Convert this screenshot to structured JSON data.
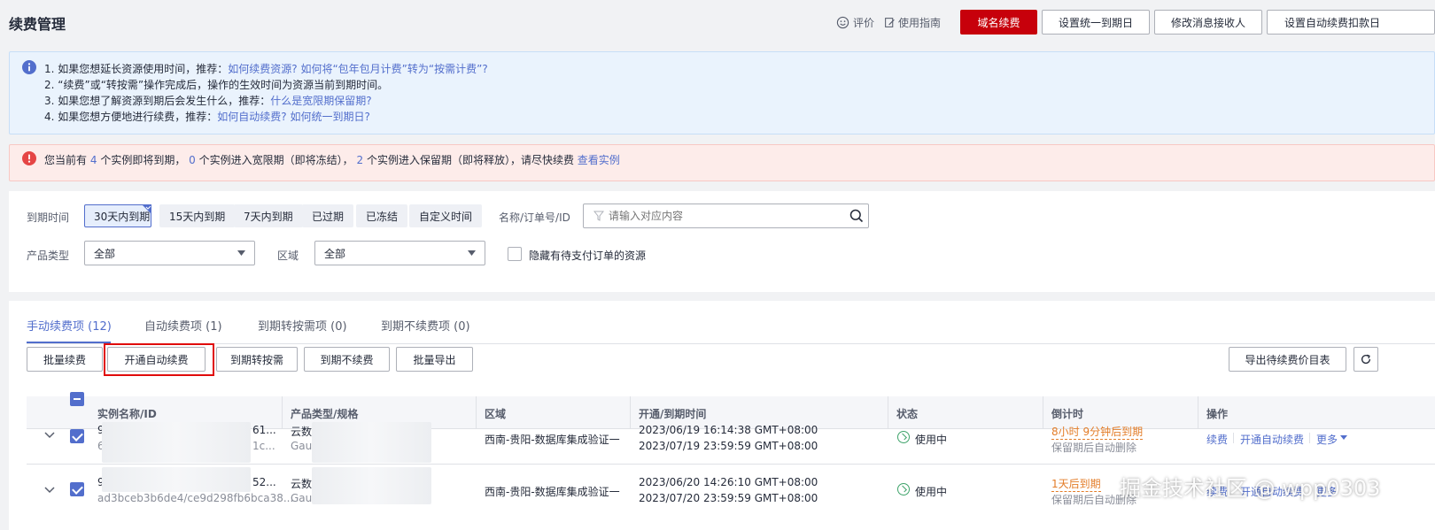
{
  "header": {
    "title": "续费管理",
    "rate_label": "评价",
    "guide_label": "使用指南",
    "buttons": [
      "域名续费",
      "设置统一到期日",
      "修改消息接收人",
      "设置自动续费扣款日"
    ]
  },
  "info": {
    "l1_text": "1. 如果您想延长资源使用时间，推荐：",
    "l1_link1": "如何续费资源?",
    "l1_link2": "如何将“包年包月计费”转为“按需计费”?",
    "l2_text": "2. “续费”或“转按需”操作完成后，操作的生效时间为资源当前到期时间。",
    "l3_text": "3. 如果您想了解资源到期后会发生什么，推荐：",
    "l3_link": "什么是宽限期保留期?",
    "l4_text": "4. 如果您想方便地进行续费，推荐：",
    "l4_link1": "如何自动续费?",
    "l4_link2": "如何统一到期日?"
  },
  "warning": {
    "p1": "您当前有",
    "n1": "4",
    "p2": "个实例即将到期，",
    "n2": "0",
    "p3": "个实例进入宽限期（即将冻结），",
    "n3": "2",
    "p4": "个实例进入保留期（即将释放），请尽快续费",
    "link": "查看实例"
  },
  "filters": {
    "expire_label": "到期时间",
    "chips": [
      "30天内到期",
      "15天内到期",
      "7天内到期",
      "已过期",
      "已冻结",
      "自定义时间"
    ],
    "search_label": "名称/订单号/ID",
    "search_placeholder": "请输入对应内容",
    "product_label": "产品类型",
    "product_value": "全部",
    "region_label": "区域",
    "region_value": "全部",
    "hide_pending_label": "隐藏有待支付订单的资源"
  },
  "tabs": [
    "手动续费项 (12)",
    "自动续费项 (1)",
    "到期转按需项 (0)",
    "到期不续费项 (0)"
  ],
  "actions": [
    "批量续费",
    "开通自动续费",
    "到期转按需",
    "到期不续费",
    "批量导出"
  ],
  "export_label": "导出待续费价目表",
  "table": {
    "headers": [
      "实例名称/ID",
      "产品类型/规格",
      "区域",
      "开通/到期时间",
      "状态",
      "倒计时",
      "操作"
    ],
    "rows": [
      {
        "name": "9",
        "name_tail": "61...",
        "id_head": "6",
        "id_tail": "1c...",
        "product": "云数",
        "spec": "Gau",
        "region": "西南-贵阳-数据库集成验证一",
        "open_time": "2023/06/19 16:14:38 GMT+08:00",
        "expire_time": "2023/07/19 23:59:59 GMT+08:00",
        "status": "使用中",
        "countdown": "8小时 9分钟后到期",
        "countdown_note": "保留期后自动删除",
        "ops": [
          "续费",
          "开通自动续费",
          "更多"
        ]
      },
      {
        "name": "9",
        "name_tail": "52...",
        "id_head": "ad3bceb3b6de4/ce9d298fb6bca38...",
        "id_tail": "",
        "product": "云数",
        "spec": "Gau",
        "region": "西南-贵阳-数据库集成验证一",
        "open_time": "2023/06/20 14:26:10 GMT+08:00",
        "expire_time": "2023/07/20 23:59:59 GMT+08:00",
        "status": "使用中",
        "countdown": "1天后到期",
        "countdown_note": "保留期后自动删除",
        "ops": [
          "续费",
          "开通自动续费",
          "更多"
        ]
      }
    ]
  },
  "watermark": "掘金技术社区 @ wpp0303",
  "colors": {
    "accent": "#526ecc",
    "danger": "#c7000b",
    "warning": "#e37d29",
    "success": "#3ea36a"
  }
}
